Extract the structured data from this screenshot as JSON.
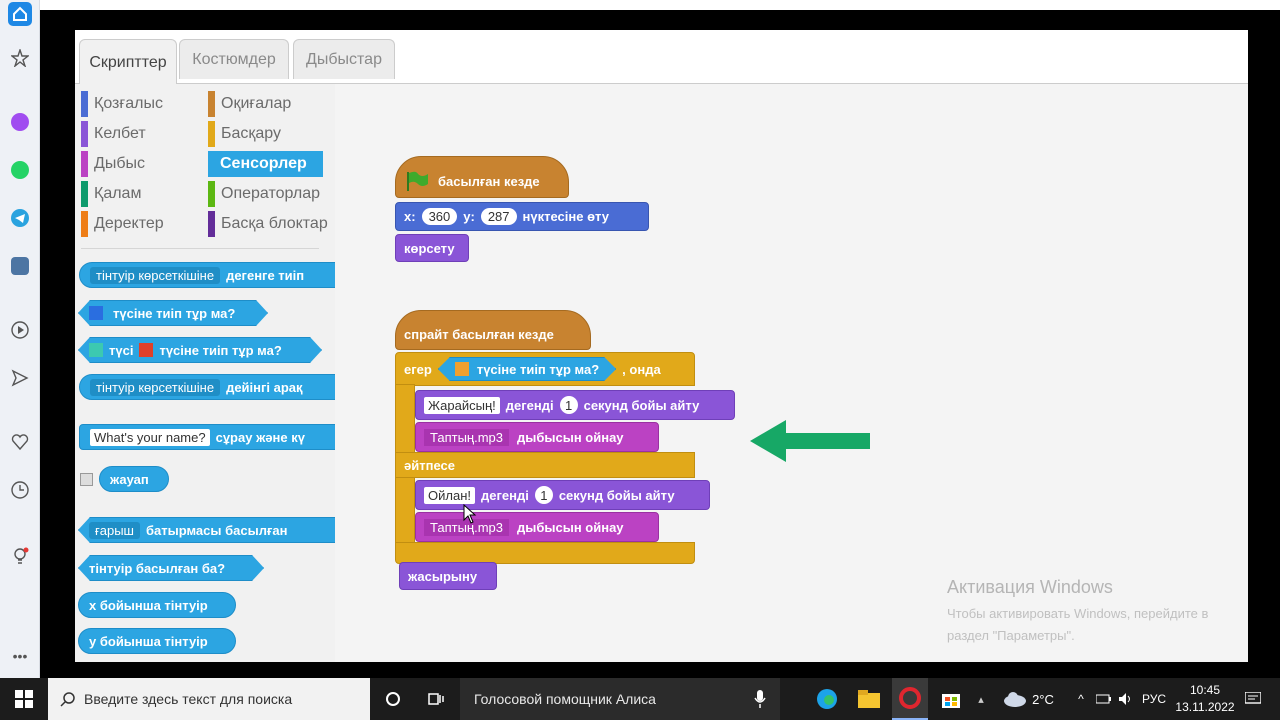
{
  "tabs": [
    "Скрипттер",
    "Костюмдер",
    "Дыбыстар"
  ],
  "categories": [
    {
      "label": "Қозғалыс",
      "color": "#4a6cd4"
    },
    {
      "label": "Келбет",
      "color": "#8a55d7"
    },
    {
      "label": "Дыбыс",
      "color": "#bb42c3"
    },
    {
      "label": "Қалам",
      "color": "#0e9a6c"
    },
    {
      "label": "Деректер",
      "color": "#ee7d16"
    },
    {
      "label": "Оқиғалар",
      "color": "#c88330"
    },
    {
      "label": "Басқару",
      "color": "#e1a91a"
    },
    {
      "label": "Сенсорлер",
      "color": "#2ca5e2"
    },
    {
      "label": "Операторлар",
      "color": "#5cb712"
    },
    {
      "label": "Басқа блоктар",
      "color": "#632d99"
    }
  ],
  "palette": {
    "b1_dd": "тінтуір көрсеткішіне",
    "b1_text": "дегенге тиіп",
    "b2_text": "түсіне тиіп тұр ма?",
    "b3_a": "түсі",
    "b3_b": "түсіне тиіп тұр ма?",
    "b4_dd": "тінтуір көрсеткішіне",
    "b4_text": "дейінгі арақ",
    "b5_input": "What's your name?",
    "b5_text": "сұрау және кү",
    "b6_text": "жауап",
    "b7_dd": "ғарыш",
    "b7_text": "батырмасы басылған",
    "b8_text": "тінтуір басылған ба?",
    "b9_text": "x бойынша тінтуір",
    "b10_text": "y бойынша тінтуір"
  },
  "script": {
    "flag_hat": "басылған кезде",
    "goto_x_label": "x:",
    "goto_x": "360",
    "goto_y_label": "y:",
    "goto_y": "287",
    "goto_tail": "нүктесіне өту",
    "show": "көрсету",
    "sprite_hat": "спрайт басылған кезде",
    "if_label": "егер",
    "if_cond": "түсіне тиіп тұр ма?",
    "if_then": ", онда",
    "say1_text": "Жарайсың!",
    "say1_mid": "дегенді",
    "say1_num": "1",
    "say1_tail": "секунд бойы айту",
    "play1_dd": "Таптың.mp3",
    "play1_tail": "дыбысын ойнау",
    "else_label": "әйтпесе",
    "say2_text": "Ойлан!",
    "say2_mid": "дегенді",
    "say2_num": "1",
    "say2_tail": "секунд бойы айту",
    "play2_dd": "Таптың.mp3",
    "play2_tail": "дыбысын ойнау",
    "hide": "жасырыну"
  },
  "watermark": {
    "title": "Активация Windows",
    "line1": "Чтобы активировать Windows, перейдите в",
    "line2": "раздел \"Параметры\"."
  },
  "taskbar": {
    "search_placeholder": "Введите здесь текст для поиска",
    "assistant": "Голосовой помощник Алиса",
    "temp": "2°C",
    "lang": "РУС",
    "time": "10:45",
    "date": "13.11.2022"
  },
  "colors": {
    "arrow": "#17a866",
    "sensing": "#2ca5e2"
  }
}
